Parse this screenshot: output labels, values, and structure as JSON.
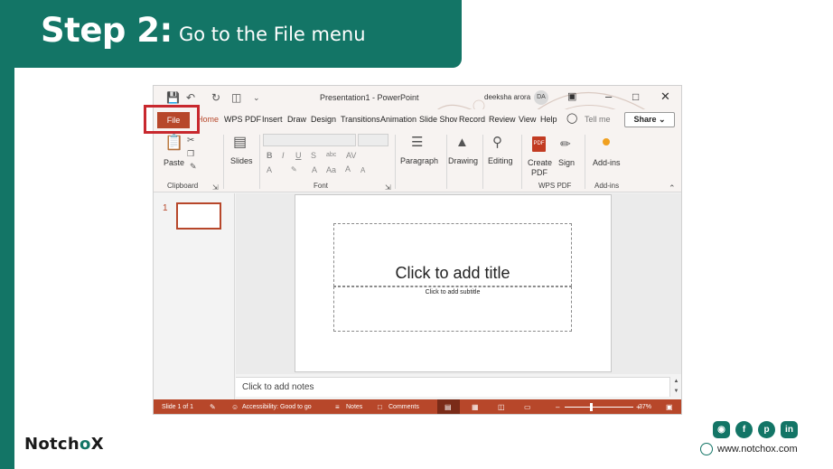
{
  "header": {
    "step_label": "Step 2:",
    "instruction": "Go to the File menu"
  },
  "window": {
    "title": "Presentation1  -  PowerPoint",
    "user_name": "deeksha arora",
    "user_initials": "DA"
  },
  "tabs": {
    "file": "File",
    "items": [
      "Home",
      "WPS PDF",
      "Insert",
      "Draw",
      "Design",
      "Transitions",
      "Animation",
      "Slide Show",
      "Record",
      "Review",
      "View",
      "Help"
    ],
    "tell_me": "Tell me",
    "share": "Share"
  },
  "ribbon": {
    "paste": "Paste",
    "clipboard": "Clipboard",
    "slides": "Slides",
    "font": "Font",
    "paragraph": "Paragraph",
    "drawing": "Drawing",
    "editing": "Editing",
    "create_pdf_line1": "Create",
    "create_pdf_line2": "PDF",
    "sign": "Sign",
    "wps_pdf": "WPS PDF",
    "addins": "Add-ins",
    "addins_group": "Add-ins"
  },
  "thumbnails": {
    "slide_number": "1"
  },
  "slide": {
    "title_placeholder": "Click to add title",
    "subtitle_placeholder": "Click to add subtitle"
  },
  "notes": {
    "placeholder": "Click to add notes"
  },
  "status": {
    "slide_count": "Slide 1 of 1",
    "accessibility": "Accessibility: Good to go",
    "notes": "Notes",
    "comments": "Comments",
    "zoom": "37%"
  },
  "footer": {
    "brand_prefix": "Notch",
    "brand_accent": "o",
    "brand_suffix": "X",
    "website": "www.notchox.com"
  },
  "colors": {
    "teal": "#137566",
    "ppt_accent": "#b7472a",
    "highlight": "#c8282e"
  },
  "icons": [
    "instagram-icon",
    "facebook-icon",
    "pinterest-icon",
    "linkedin-icon",
    "globe-icon"
  ]
}
